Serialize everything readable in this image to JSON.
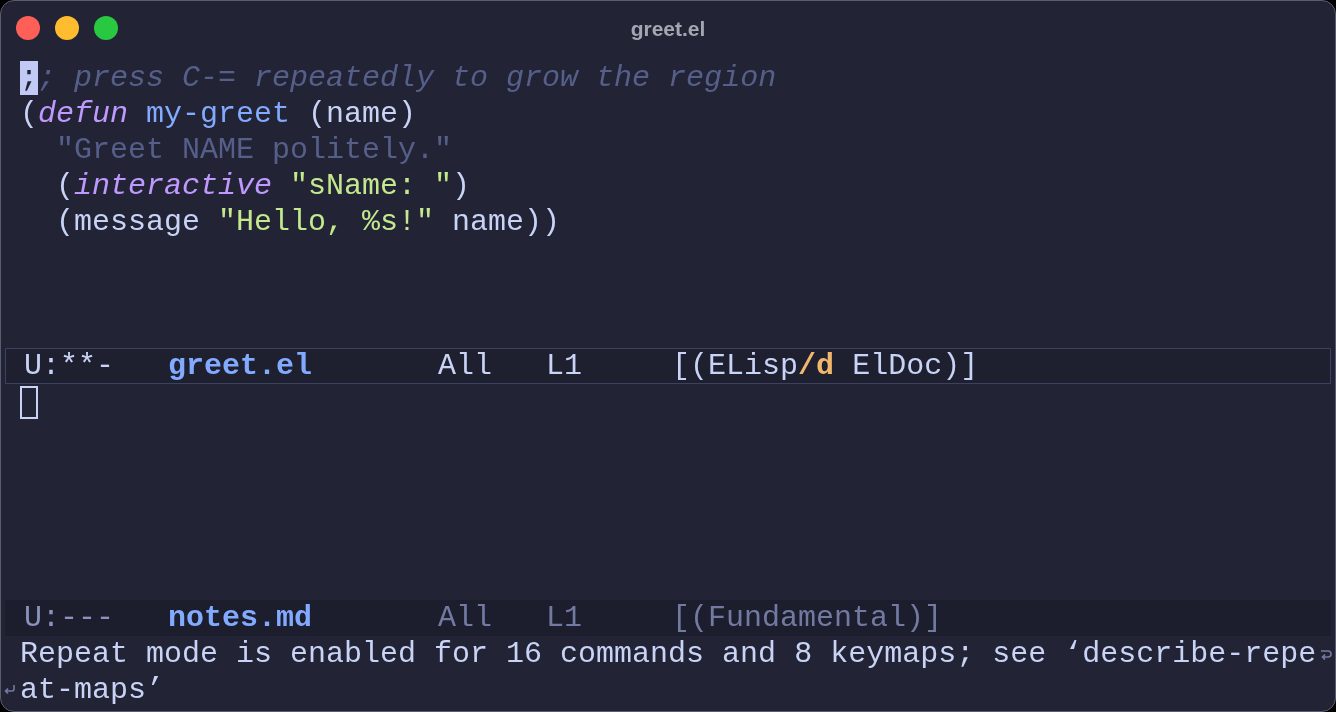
{
  "window": {
    "title": "greet.el"
  },
  "windows": [
    {
      "selected": true,
      "lines": [
        {
          "tokens": [
            {
              "kind": "cursor",
              "text": ";"
            },
            {
              "kind": "comment",
              "text": "; press C-= repeatedly to grow the region"
            }
          ]
        },
        {
          "tokens": [
            {
              "kind": "plain",
              "text": "("
            },
            {
              "kind": "keyword",
              "text": "defun "
            },
            {
              "kind": "function",
              "text": "my-greet"
            },
            {
              "kind": "plain",
              "text": " (name)"
            }
          ],
          "children": [
            {
              "tokens": [
                {
                  "kind": "doc",
                  "text": "\"Greet NAME politely.\""
                }
              ]
            },
            {
              "tokens": [
                {
                  "kind": "plain",
                  "text": "("
                },
                {
                  "kind": "keyword",
                  "text": "interactive "
                },
                {
                  "kind": "string",
                  "text": "\"sName: \""
                },
                {
                  "kind": "plain",
                  "text": ")"
                }
              ]
            },
            {
              "tokens": [
                {
                  "kind": "plain",
                  "text": "(message "
                },
                {
                  "kind": "string",
                  "text": "\"Hello, %s!\""
                },
                {
                  "kind": "plain",
                  "text": " name))"
                }
              ]
            }
          ]
        }
      ],
      "mode_line": {
        "status": "U:**-",
        "buffer": "greet.el",
        "position": "All",
        "line": "L1",
        "modes": "[(ELisp**/d** ElDoc)]"
      }
    },
    {
      "selected": false,
      "mode_line": {
        "status": "U:---",
        "buffer": "notes.md",
        "position": "All",
        "line": "L1",
        "modes": "[(Fundamental)]"
      }
    }
  ],
  "echo_area": {
    "lines": [
      "Repeat mode is enabled for 16 commands and 8 keymaps; see ‘describe-repe",
      "at-maps’"
    ]
  }
}
